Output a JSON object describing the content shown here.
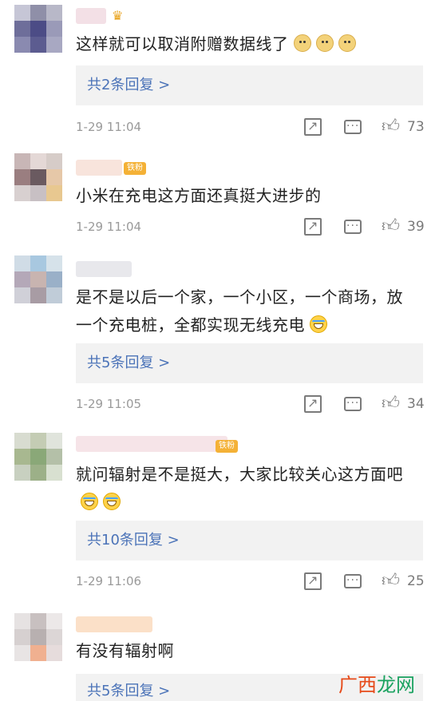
{
  "comments": [
    {
      "text": "这样就可以取消附赠数据线了",
      "emojis": [
        "doge",
        "doge",
        "doge"
      ],
      "replies": "共2条回复 >",
      "time": "1-29 11:04",
      "likes": "73",
      "avatar_colors": [
        "#c6c6d6",
        "#8f8fa8",
        "#b8b8c8",
        "#6e6e9a",
        "#4c4c86",
        "#9a9ab8",
        "#8a8ab0",
        "#5c5c90",
        "#a8a8c2"
      ],
      "name_color": "#f3e0e6"
    },
    {
      "text": "小米在充电这方面还真挺大进步的",
      "emojis": [],
      "badge": "铁粉",
      "time": "1-29 11:04",
      "likes": "39",
      "avatar_colors": [
        "#c8b6b6",
        "#e4d8d6",
        "#d6ccc8",
        "#9a7e80",
        "#6a5a60",
        "#e6c8a8",
        "#d8d0d0",
        "#c8c0c4",
        "#e8c890"
      ],
      "name_color": "#f8e4dc"
    },
    {
      "text": "是不是以后一个家，一个小区，一个商场，放一个充电桩，全都实现无线充电",
      "emojis": [
        "laugh"
      ],
      "replies": "共5条回复 >",
      "time": "1-29 11:05",
      "likes": "34",
      "avatar_colors": [
        "#d0dce6",
        "#a8c8e0",
        "#d6e2ea",
        "#b4a8b8",
        "#c8b4b0",
        "#9ab0c8",
        "#d0d0d8",
        "#a89ca4",
        "#c0ccd8"
      ],
      "name_color": "#e8e8ec"
    },
    {
      "text": "就问辐射是不是挺大，大家比较关心这方面吧",
      "emojis": [
        "laugh",
        "laugh"
      ],
      "badge": "铁粉",
      "replies": "共10条回复 >",
      "time": "1-29 11:06",
      "likes": "25",
      "avatar_colors": [
        "#d8dcd0",
        "#c4ccb4",
        "#e0e4dc",
        "#a8b890",
        "#8aa878",
        "#b4c0a8",
        "#c8d0c0",
        "#9cb088",
        "#d8e0d0"
      ],
      "name_color": "#f6e4e8"
    },
    {
      "text": "有没有辐射啊",
      "emojis": [],
      "replies": "共5条回复 >",
      "avatar_colors": [
        "#e6e2e2",
        "#c8c0c0",
        "#ece8e8",
        "#d6d0d0",
        "#b8b0b0",
        "#dcd6d6",
        "#e8e4e4",
        "#f0b090",
        "#e6dcdc"
      ],
      "name_color": "#fbe0c8"
    }
  ],
  "watermark": {
    "part1": "广西",
    "part2": "龙网"
  }
}
